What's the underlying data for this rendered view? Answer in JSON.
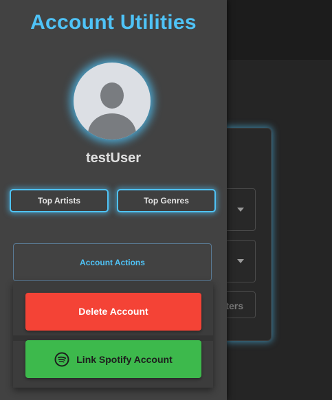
{
  "drawer": {
    "title": "Account Utilities",
    "username": "testUser",
    "stats": {
      "top_artists_label": "Top Artists",
      "top_genres_label": "Top Genres"
    },
    "account_actions": {
      "toggle_label": "Account Actions",
      "delete_label": "Delete Account",
      "spotify_label": "Link Spotify Account"
    }
  },
  "background": {
    "button_partial_text": "ters"
  },
  "colors": {
    "accent": "#4fc3f7",
    "danger": "#f44336",
    "spotify": "#3db94c",
    "drawer_bg": "#424242"
  },
  "icons": {
    "avatar": "user-avatar-icon",
    "spotify": "spotify-icon",
    "dropdown": "caret-down-icon"
  }
}
